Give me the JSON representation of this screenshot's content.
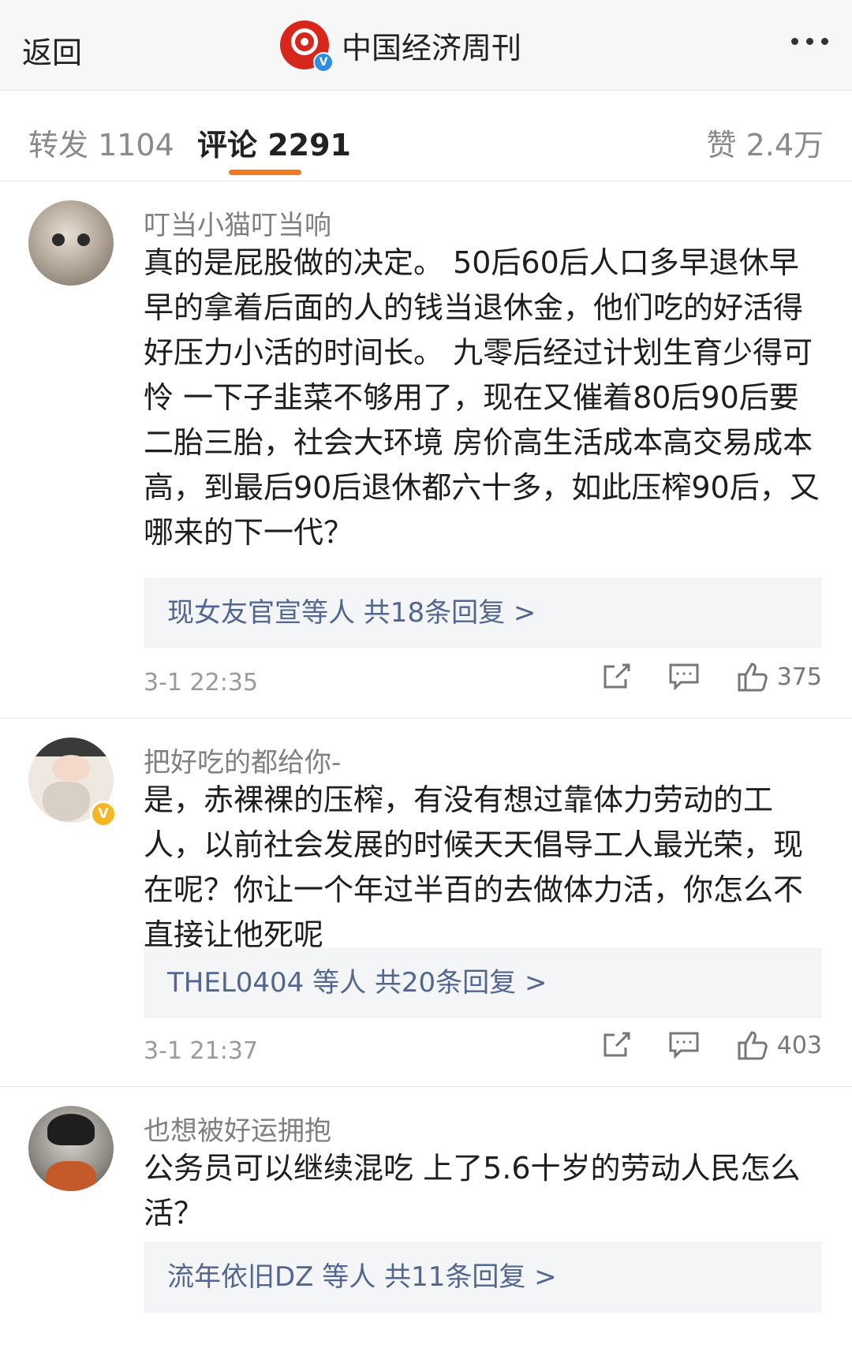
{
  "header": {
    "back_label": "返回",
    "account_name": "中国经济周刊",
    "logo_text": "中国经济周刊",
    "verified_badge": "V",
    "brand_color": "#d7261c"
  },
  "tabs": {
    "repost": "转发 1104",
    "comments": "评论 2291",
    "likes": "赞 2.4万",
    "active_color": "#f27a23"
  },
  "comments": [
    {
      "username": "叮当小猫叮当响",
      "text": "真的是屁股做的决定。 50后60后人口多早退休早早的拿着后面的人的钱当退休金，他们吃的好活得好压力小活的时间长。 九零后经过计划生育少得可怜 一下子韭菜不够用了，现在又催着80后90后要二胎三胎，社会大环境 房价高生活成本高交易成本高，到最后90后退休都六十多，如此压榨90后，又哪来的下一代？",
      "replies": "现女友官宣等人  共18条回复 >",
      "time": "3-1 22:35",
      "likes": "375"
    },
    {
      "username": "把好吃的都给你-",
      "text": "是，赤裸裸的压榨，有没有想过靠体力劳动的工人，以前社会发展的时候天天倡导工人最光荣，现在呢？你让一个年过半百的去做体力活，你怎么不直接让他死呢",
      "replies": "THEL0404 等人  共20条回复 >",
      "time": "3-1 21:37",
      "likes": "403",
      "badge": "V"
    },
    {
      "username": "也想被好运拥抱",
      "text": "公务员可以继续混吃 上了5.6十岁的劳动人民怎么活？",
      "replies": "流年依旧DZ 等人  共11条回复 >"
    }
  ],
  "icons": {
    "share": "share-icon",
    "comment": "comment-icon",
    "like": "like-icon"
  }
}
